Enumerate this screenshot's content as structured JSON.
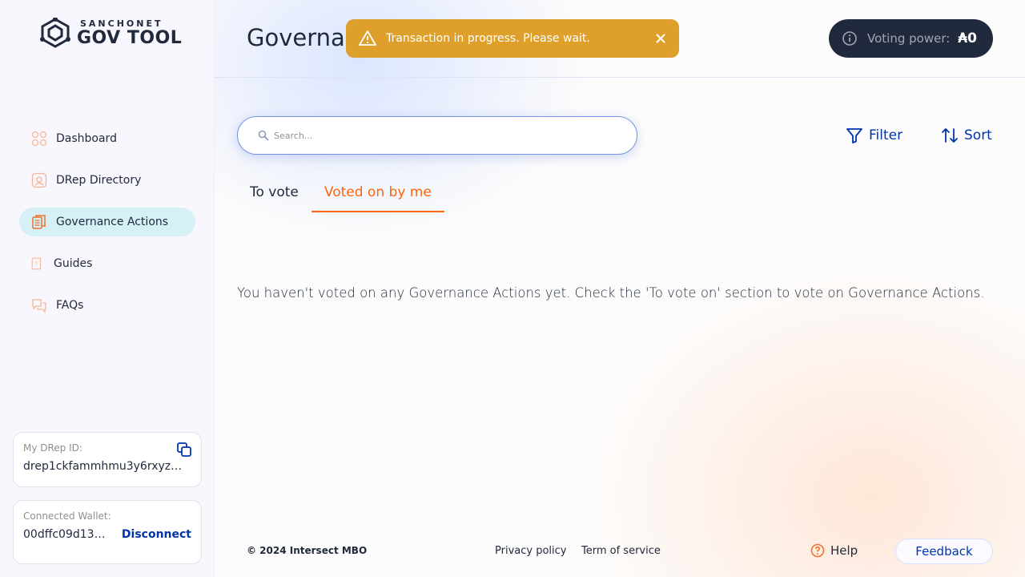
{
  "brand": {
    "sub": "SANCHONET",
    "main": "GOV TOOL"
  },
  "nav": {
    "items": [
      {
        "label": "Dashboard",
        "icon": "dashboard-icon"
      },
      {
        "label": "DRep Directory",
        "icon": "drep-directory-icon"
      },
      {
        "label": "Governance Actions",
        "icon": "governance-actions-icon",
        "active": true
      },
      {
        "label": "Guides",
        "icon": "guides-icon"
      },
      {
        "label": "FAQs",
        "icon": "faqs-icon"
      }
    ]
  },
  "drep_card": {
    "label": "My DRep ID:",
    "value": "drep1ckfammhmu3y6rxyzy…"
  },
  "wallet_card": {
    "label": "Connected Wallet:",
    "value": "00dffc09d13b…",
    "disconnect": "Disconnect"
  },
  "header": {
    "title": "Governance Actions",
    "voting_power_label": "Voting power:",
    "voting_power_value": "₳0"
  },
  "toast": {
    "message": "Transaction in progress. Please wait."
  },
  "search": {
    "placeholder": "Search..."
  },
  "toolbar": {
    "filter": "Filter",
    "sort": "Sort"
  },
  "tabs": [
    {
      "label": "To vote",
      "active": false
    },
    {
      "label": "Voted on by me",
      "active": true
    }
  ],
  "empty_message": "You haven't voted on any Governance Actions yet. Check the 'To vote on' section to vote on Governance Actions.",
  "footer": {
    "copyright": "© 2024 Intersect MBO",
    "privacy": "Privacy policy",
    "terms": "Term of service",
    "help": "Help",
    "feedback": "Feedback"
  },
  "colors": {
    "accent_orange": "#ff640a",
    "primary_blue": "#0033ad",
    "toast_yellow": "#dea02a",
    "dark": "#212a3d",
    "active_nav": "#d6f1f6"
  }
}
